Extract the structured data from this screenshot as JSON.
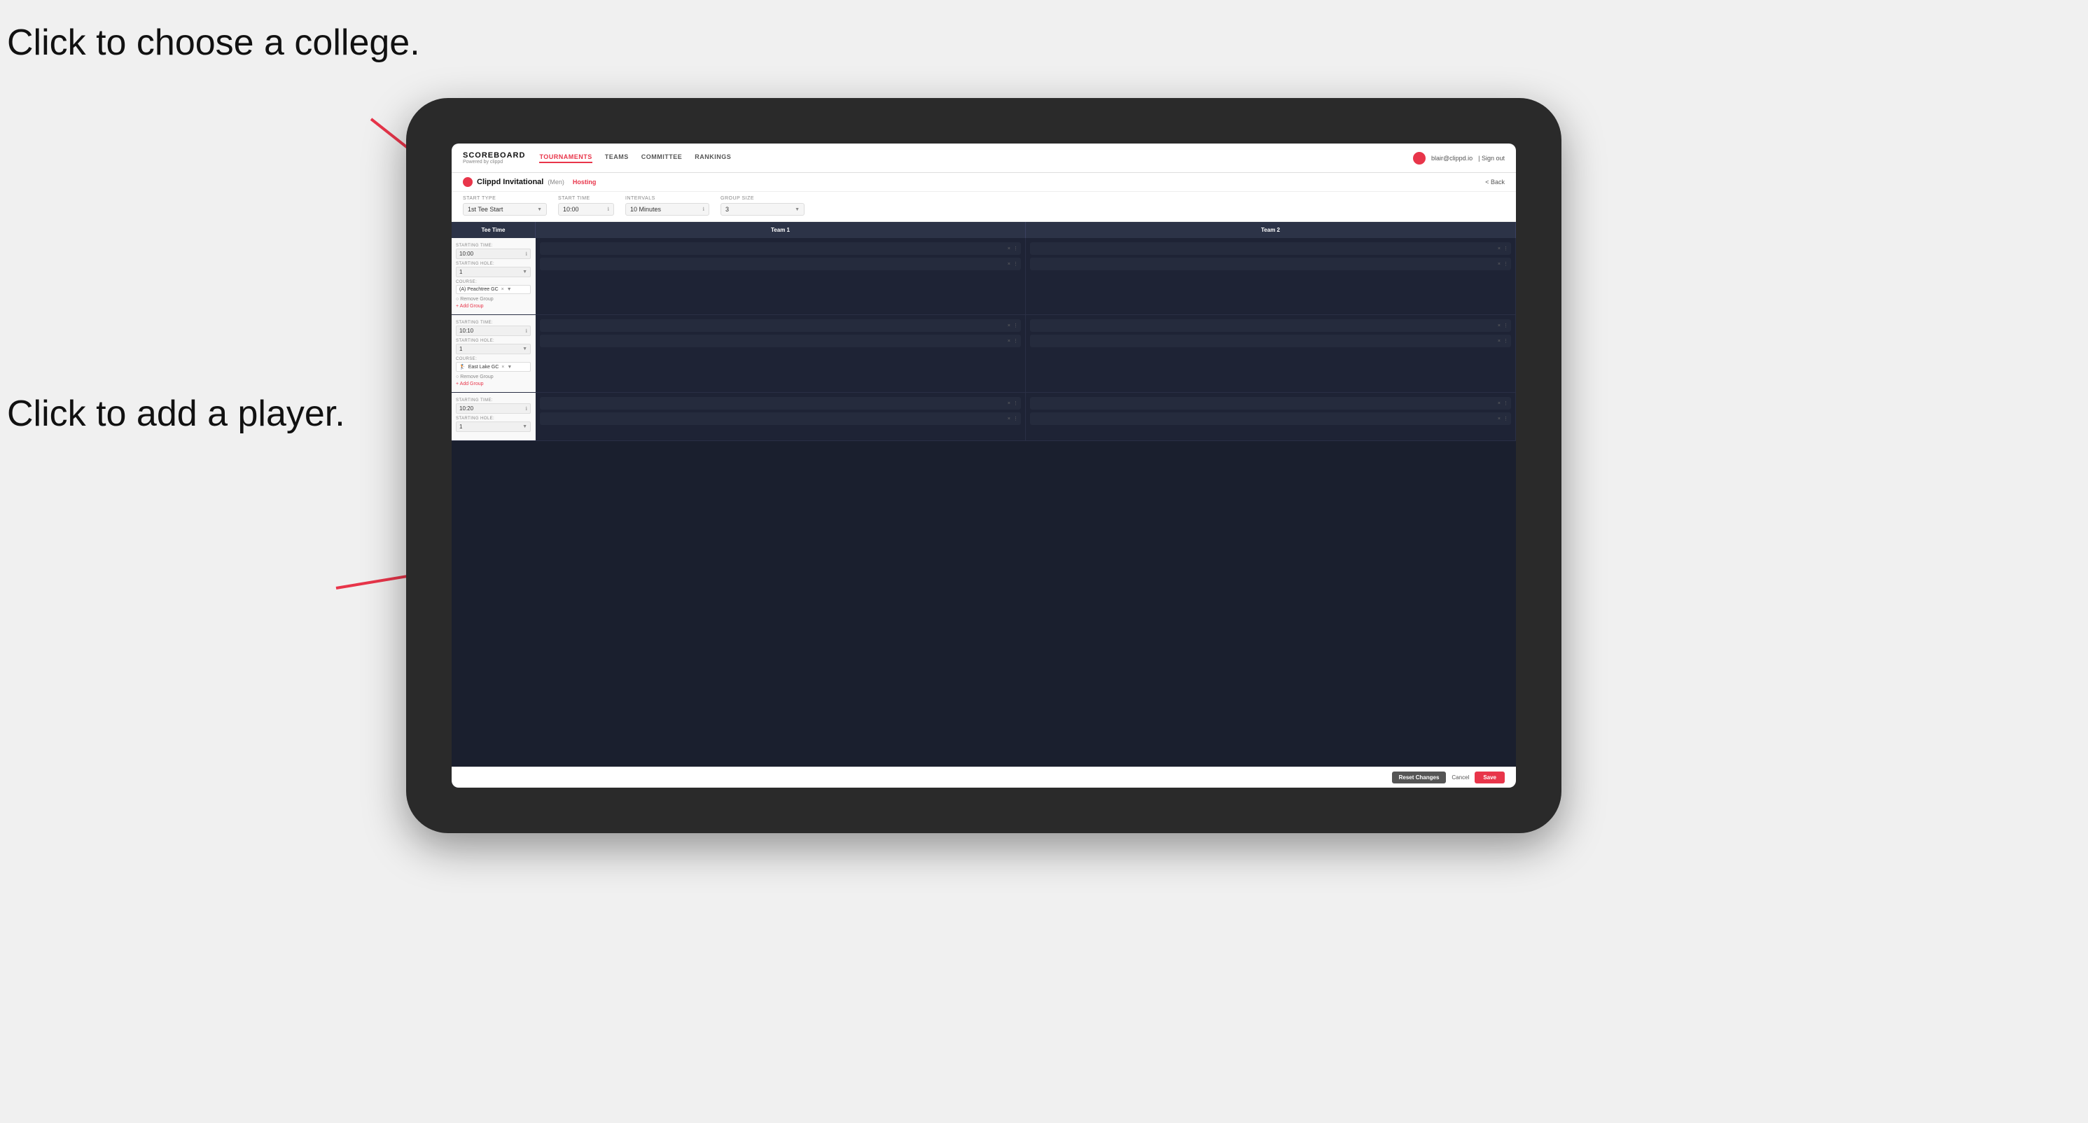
{
  "annotations": {
    "college": "Click to choose a\ncollege.",
    "player": "Click to add\na player."
  },
  "nav": {
    "brand": "SCOREBOARD",
    "brand_sub": "Powered by clippd",
    "links": [
      "TOURNAMENTS",
      "TEAMS",
      "COMMITTEE",
      "RANKINGS"
    ],
    "active_link": "TOURNAMENTS",
    "user_email": "blair@clippd.io",
    "sign_out": "| Sign out"
  },
  "sub_header": {
    "event_name": "Clippd Invitational",
    "event_tag": "(Men)",
    "hosting": "Hosting",
    "back": "< Back"
  },
  "controls": {
    "start_type_label": "Start Type",
    "start_type_value": "1st Tee Start",
    "start_time_label": "Start Time",
    "start_time_value": "10:00",
    "intervals_label": "Intervals",
    "intervals_value": "10 Minutes",
    "group_size_label": "Group Size",
    "group_size_value": "3"
  },
  "table": {
    "col_tee": "Tee Time",
    "col_team1": "Team 1",
    "col_team2": "Team 2"
  },
  "groups": [
    {
      "starting_time_label": "STARTING TIME:",
      "starting_time": "10:00",
      "starting_hole_label": "STARTING HOLE:",
      "starting_hole": "1",
      "course_label": "COURSE:",
      "course": "(A) Peachtree GC",
      "remove_group": "Remove Group",
      "add_group": "+ Add Group",
      "team1_slots": 2,
      "team2_slots": 2
    },
    {
      "starting_time_label": "STARTING TIME:",
      "starting_time": "10:10",
      "starting_hole_label": "STARTING HOLE:",
      "starting_hole": "1",
      "course_label": "COURSE:",
      "course": "East Lake GC",
      "remove_group": "Remove Group",
      "add_group": "+ Add Group",
      "team1_slots": 2,
      "team2_slots": 2
    },
    {
      "starting_time_label": "STARTING TIME:",
      "starting_time": "10:20",
      "starting_hole_label": "STARTING HOLE:",
      "starting_hole": "1",
      "course_label": "",
      "course": "",
      "remove_group": "",
      "add_group": "",
      "team1_slots": 2,
      "team2_slots": 2
    }
  ],
  "footer": {
    "reset_label": "Reset Changes",
    "cancel_label": "Cancel",
    "save_label": "Save"
  }
}
